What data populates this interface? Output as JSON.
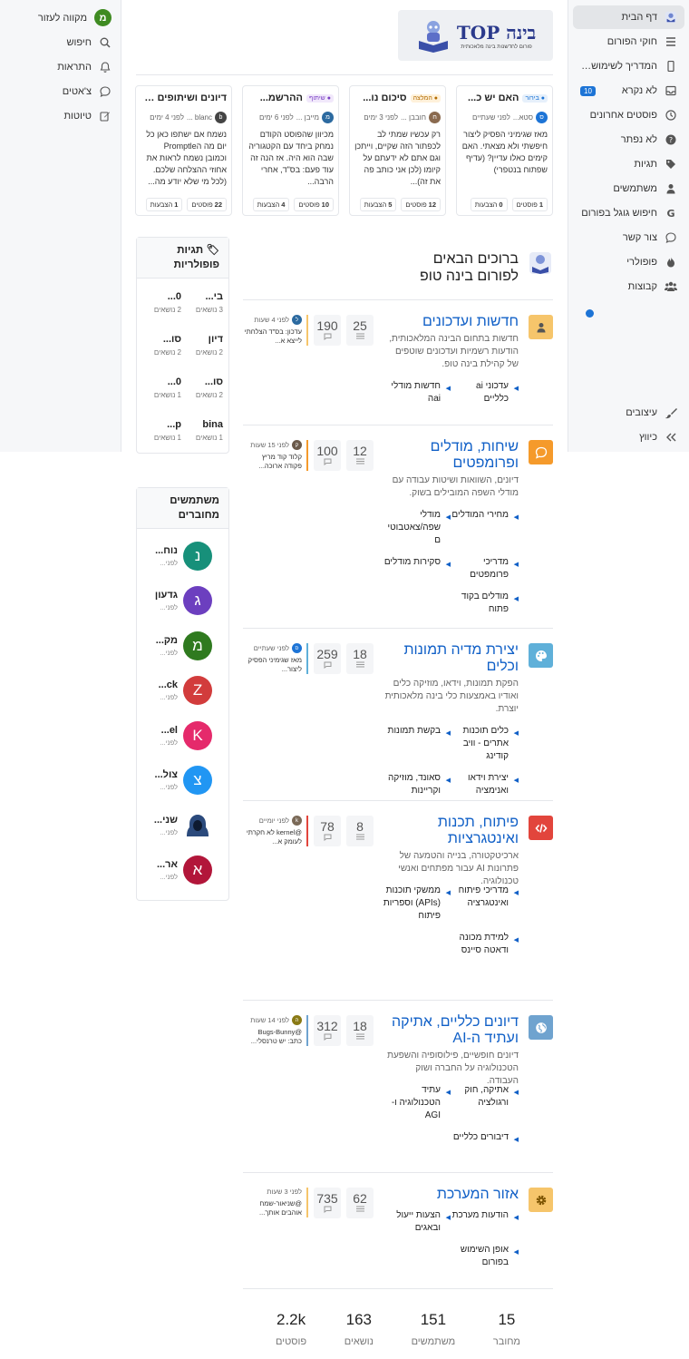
{
  "sidebar": {
    "items": [
      {
        "label": "דף הבית",
        "icon": "home-logo-icon",
        "active": true
      },
      {
        "label": "חוקי הפורום",
        "icon": "list-icon"
      },
      {
        "label": "המדריך לשימוש בפור...",
        "icon": "phone-icon"
      },
      {
        "label": "לא נקרא",
        "icon": "inbox-icon",
        "badge": "10"
      },
      {
        "label": "פוסטים אחרונים",
        "icon": "clock-icon"
      },
      {
        "label": "לא נפתר",
        "icon": "question-icon"
      },
      {
        "label": "תגיות",
        "icon": "tags-icon"
      },
      {
        "label": "משתמשים",
        "icon": "user-icon"
      },
      {
        "label": "חיפוש גוגל בפורום",
        "icon": "google-icon"
      },
      {
        "label": "צור קשר",
        "icon": "chat-icon"
      },
      {
        "label": "פופולרי",
        "icon": "fire-icon"
      },
      {
        "label": "קבוצות",
        "icon": "users-icon"
      }
    ],
    "bottom": [
      {
        "label": "עיצובים",
        "icon": "brush-icon"
      },
      {
        "label": "כיווץ",
        "icon": "collapse-icon"
      }
    ]
  },
  "rightbar": {
    "user_initial": "מ",
    "user_name": "מקווה לעזור",
    "items": [
      {
        "label": "חיפוש",
        "icon": "search-icon"
      },
      {
        "label": "התראות",
        "icon": "bell-icon"
      },
      {
        "label": "צ'אטים",
        "icon": "chat-icon"
      },
      {
        "label": "טיוטות",
        "icon": "edit-icon"
      }
    ]
  },
  "logo": {
    "title": "בינה TOP",
    "subtitle": "פורום לחדשנות בינה מלאכותית"
  },
  "carousel": [
    {
      "chip": "בירור",
      "chip_color": "#1d74d6",
      "chip_bg": "#e6f0fb",
      "title": "האם יש כ...",
      "author": "סטא...",
      "av": "ס",
      "av_bg": "#1d74d6",
      "time": "לפני שעתיים",
      "body": "מאז שגימיני הפסיק ליצור חיפשתי ולא מצאתי. האם קימים כאלו עדיין? (עדיף שפתוח בנטפרי)",
      "posts": "1",
      "votes": "0"
    },
    {
      "chip": "המלצה",
      "chip_color": "#b36b00",
      "chip_bg": "#fff1da",
      "title": "סיכום נו...",
      "author": "חובבן ...",
      "av": "ח",
      "av_bg": "#8a6a4f",
      "time": "לפני 3 ימים",
      "body": "רק עכשיו שמתי לב לכפתור הזה שקיים, וייתכן וגם אתם לא ידעתם על קיומו (לכן אני כותב פה את זה)...",
      "posts": "12",
      "votes": "5"
    },
    {
      "chip": "שיתוף",
      "chip_color": "#7a3fc4",
      "chip_bg": "#f1e8fb",
      "title": "ההרשמ...",
      "author": "מייבן ...",
      "av": "מ",
      "av_bg": "#2c6aa0",
      "time": "לפני 6 ימים",
      "body": "מכיוון שהפוסט הקודם נמחק ביחד עם הקטגוריה שבה הוא היה. אז הנה זה עוד פעם: בס\"ד, אחרי הרבה...",
      "posts": "10",
      "votes": "4"
    },
    {
      "chip": "",
      "chip_color": "",
      "chip_bg": "",
      "title": "דיונים ושיתופים על...",
      "author": "blanc ...",
      "av": "b",
      "av_bg": "#444",
      "time": "לפני 4 ימים",
      "body": "נשמח אם ישתפו כאן כל יום מה הPromptle וכמובן נשמח לראות את אחוזי ההצלחה שלכם. (לכל מי שלא יודע מה...",
      "posts": "22",
      "votes": "1"
    }
  ],
  "welcome_title": "ברוכים הבאים לפורום בינה טופ",
  "categories": [
    {
      "title": "חדשות ועדכונים",
      "icon": "user-icon",
      "color": "#f6c56b",
      "icon_color": "#7a5200",
      "desc": "חדשות בתחום הבינה המלאכותית, הודעות רשמיות ועדכונים שוטפים של קהילת בינה טופ.",
      "subs": [
        "עדכוני ai כלליים",
        "חדשות מודלי aiה"
      ],
      "topics": "25",
      "posts": "190",
      "tcolor": "#f6c56b",
      "t_time": "לפני 4 שעות",
      "t_text": "עדכון: בס\"ד הצלחתי לייצא א...",
      "t_av": "ל",
      "t_av_bg": "#2c6aa0"
    },
    {
      "title": "שיחות, מודלים ופרומפטים",
      "icon": "chat-bubble-icon",
      "color": "#f59a2b",
      "icon_color": "#ffffff",
      "desc": "דיונים, השוואות ושיטות עבודה עם מודלי השפה המובילים בשוק.",
      "subs": [
        "מחירי המודלים",
        "מודלי שפה/צאטבוטי ם",
        "מדריכי פרומפטים",
        "סקירות מודלים",
        "מודלים בקוד פתוח"
      ],
      "topics": "12",
      "posts": "100",
      "tcolor": "#f59a2b",
      "t_time": "לפני 15 שעות",
      "t_text": "קלוד קוד מריץ פקודה ארוכה...",
      "t_av": "ק",
      "t_av_bg": "#6b5a4a"
    },
    {
      "title": "יצירת מדיה תמונות וכלים",
      "icon": "palette-icon",
      "color": "#5fb0d9",
      "icon_color": "#ffffff",
      "desc": "הפקת תמונות, וידאו, מוזיקה כלים ואודיו באמצעות כלי בינה מלאכותית יוצרת.",
      "subs": [
        "כלים תוכנות אתרים - וויב קודינג",
        "בקשת תמונות",
        "יצירת וידאו ואנימציה",
        "סאונד, מוזיקה וקריינות"
      ],
      "topics": "18",
      "posts": "259",
      "tcolor": "#5fb0d9",
      "t_time": "לפני שעתיים",
      "t_text": "מאז שגימיני הפסיק ליצור...",
      "t_av": "ס",
      "t_av_bg": "#1d74d6"
    },
    {
      "title": "פיתוח, תכנות ואינטגרציות",
      "icon": "code-icon",
      "color": "#e2453c",
      "icon_color": "#ffffff",
      "desc": "ארכיטקטורה, בנייה והטמעה של פתרונות AI עבור מפתחים ואנשי טכנולוגיה.",
      "subs": [
        "מדריכי פיתוח ואינטגרציה",
        "ממשקי תוכנות (APIs) וספריות פיתוח",
        "למידת מכונה ודאטה סיינס"
      ],
      "topics": "8",
      "posts": "78",
      "tcolor": "#e2453c",
      "t_time": "לפני יומיים",
      "t_text": "@kernel לא חקרתי לעומק א...",
      "t_av": "k",
      "t_av_bg": "#7b6a58"
    },
    {
      "title": "דיונים כלליים, אתיקה ועתיד ה-AI",
      "icon": "globe-icon",
      "color": "#6fa3cf",
      "icon_color": "#ffffff",
      "desc": "דיונים חופשיים, פילוסופיה והשפעת הטכנולוגיה על החברה ושוק העבודה.",
      "subs": [
        "אתיקה, חוק ורגולציה",
        "עתיד הטכנולוגיה ו-AGI",
        "דיבורים כלליים"
      ],
      "topics": "18",
      "posts": "312",
      "tcolor": "#6fa3cf",
      "t_time": "לפני 14 שעות",
      "t_text": "@Bugs-Bunny כתב: יש טרנסלי...",
      "t_av": "ה",
      "t_av_bg": "#8a7a15"
    },
    {
      "title": "אזור המערכת",
      "icon": "gear-icon",
      "color": "#f6c56b",
      "icon_color": "#7a5200",
      "desc": "",
      "subs": [
        "הודעות מערכת",
        "הצעות ייעול ובאגים",
        "אופן השימוש בפורום"
      ],
      "topics": "62",
      "posts": "735",
      "tcolor": "#f6c56b",
      "t_time": "לפני 3 שעות",
      "t_text": "@שניאור-שמח אוהבים אותך...",
      "t_av": "",
      "t_av_bg": ""
    }
  ],
  "popular_tags": {
    "title": "תגיות פופולריות",
    "tags": [
      {
        "name": "בי...",
        "count": "3 נושאים"
      },
      {
        "name": "0...",
        "count": "2 נושאים"
      },
      {
        "name": "דיון",
        "count": "2 נושאים"
      },
      {
        "name": "סו...",
        "count": "2 נושאים"
      },
      {
        "name": "סו...",
        "count": "2 נושאים"
      },
      {
        "name": "0...",
        "count": "1 נושאים"
      },
      {
        "name": "bina",
        "count": "1 נושאים"
      },
      {
        "name": "p...",
        "count": "1 נושאים"
      }
    ]
  },
  "online_users": {
    "title": "משתמשים מחוברים",
    "users": [
      {
        "initial": "נ",
        "name": "נוח...",
        "sub": "לפני...",
        "bg": "#17907a"
      },
      {
        "initial": "ג",
        "name": "גדעון",
        "sub": "לפני...",
        "bg": "#6c3fbf"
      },
      {
        "initial": "מ",
        "name": "מק...",
        "sub": "לפני...",
        "bg": "#2f7a1f"
      },
      {
        "initial": "Z",
        "name": "ck...",
        "sub": "לפני...",
        "bg": "#d23c3c"
      },
      {
        "initial": "K",
        "name": "el...",
        "sub": "לפני...",
        "bg": "#e52a6b"
      },
      {
        "initial": "צ",
        "name": "צול...",
        "sub": "לפני...",
        "bg": "#2196f3"
      },
      {
        "initial": "",
        "name": "שני...",
        "sub": "לפני...",
        "bg": "#2b4a7c"
      },
      {
        "initial": "א",
        "name": "אר...",
        "sub": "לפני...",
        "bg": "#b2163a"
      }
    ]
  },
  "totals": [
    {
      "n": "15",
      "l": "מחובר"
    },
    {
      "n": "151",
      "l": "משתמשים"
    },
    {
      "n": "163",
      "l": "נושאים"
    },
    {
      "n": "2.2k",
      "l": "פוסטים"
    }
  ]
}
